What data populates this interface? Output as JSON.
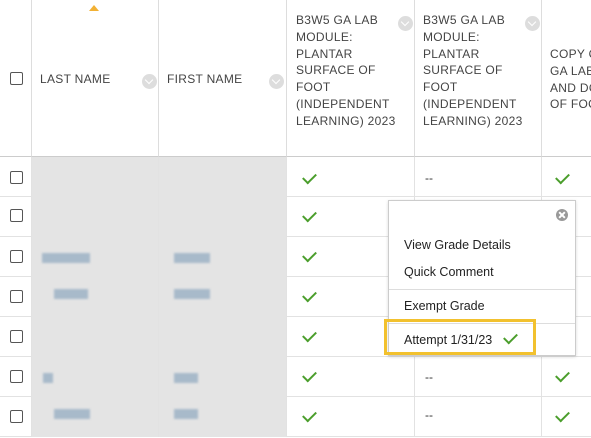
{
  "columns": {
    "last_name": "LAST NAME",
    "first_name": "FIRST NAME",
    "col1": "B3W5 GA LAB MODULE: PLANTAR SURFACE OF FOOT (INDEPENDENT LEARNING) 2023",
    "col2": "B3W5 GA LAB MODULE: PLANTAR SURFACE OF FOOT (INDEPENDENT LEARNING) 2023",
    "col3": "COPY OF GA LAB AND DO OF FOOT"
  },
  "rows": [
    {
      "col2": ""
    },
    {
      "col2": "--"
    },
    {
      "col2": ""
    },
    {
      "col2": ""
    },
    {
      "col2": ""
    },
    {
      "col2": "--"
    },
    {
      "col2": "--"
    }
  ],
  "row1_col2": "--",
  "popup": {
    "items": [
      "View Grade Details",
      "Quick Comment",
      "Exempt Grade"
    ],
    "attempt": "Attempt 1/31/23"
  },
  "colors": {
    "accent": "#f2c12e",
    "check": "#4b9e2c"
  },
  "icons": {
    "sort": "sort-ascending-icon",
    "chevron": "chevron-down-icon",
    "close": "close-icon",
    "check": "checkmark-icon"
  }
}
